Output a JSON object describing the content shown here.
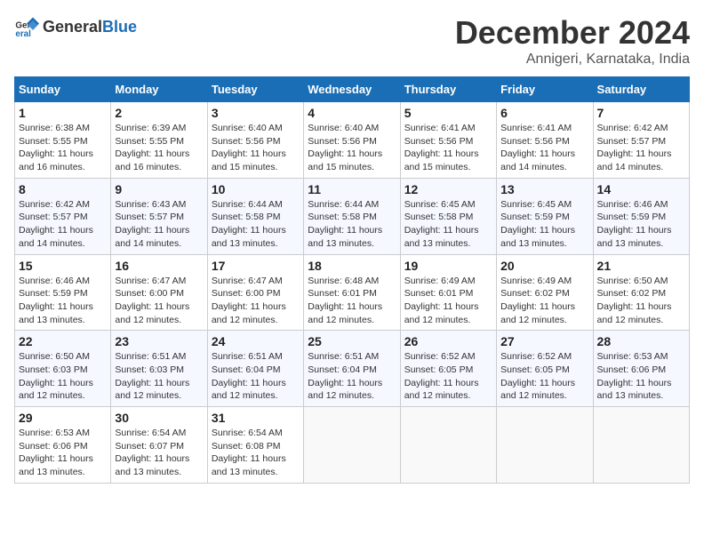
{
  "logo": {
    "text_general": "General",
    "text_blue": "Blue"
  },
  "title": "December 2024",
  "subtitle": "Annigeri, Karnataka, India",
  "weekdays": [
    "Sunday",
    "Monday",
    "Tuesday",
    "Wednesday",
    "Thursday",
    "Friday",
    "Saturday"
  ],
  "weeks": [
    [
      {
        "day": "1",
        "sunrise": "Sunrise: 6:38 AM",
        "sunset": "Sunset: 5:55 PM",
        "daylight": "Daylight: 11 hours and 16 minutes."
      },
      {
        "day": "2",
        "sunrise": "Sunrise: 6:39 AM",
        "sunset": "Sunset: 5:55 PM",
        "daylight": "Daylight: 11 hours and 16 minutes."
      },
      {
        "day": "3",
        "sunrise": "Sunrise: 6:40 AM",
        "sunset": "Sunset: 5:56 PM",
        "daylight": "Daylight: 11 hours and 15 minutes."
      },
      {
        "day": "4",
        "sunrise": "Sunrise: 6:40 AM",
        "sunset": "Sunset: 5:56 PM",
        "daylight": "Daylight: 11 hours and 15 minutes."
      },
      {
        "day": "5",
        "sunrise": "Sunrise: 6:41 AM",
        "sunset": "Sunset: 5:56 PM",
        "daylight": "Daylight: 11 hours and 15 minutes."
      },
      {
        "day": "6",
        "sunrise": "Sunrise: 6:41 AM",
        "sunset": "Sunset: 5:56 PM",
        "daylight": "Daylight: 11 hours and 14 minutes."
      },
      {
        "day": "7",
        "sunrise": "Sunrise: 6:42 AM",
        "sunset": "Sunset: 5:57 PM",
        "daylight": "Daylight: 11 hours and 14 minutes."
      }
    ],
    [
      {
        "day": "8",
        "sunrise": "Sunrise: 6:42 AM",
        "sunset": "Sunset: 5:57 PM",
        "daylight": "Daylight: 11 hours and 14 minutes."
      },
      {
        "day": "9",
        "sunrise": "Sunrise: 6:43 AM",
        "sunset": "Sunset: 5:57 PM",
        "daylight": "Daylight: 11 hours and 14 minutes."
      },
      {
        "day": "10",
        "sunrise": "Sunrise: 6:44 AM",
        "sunset": "Sunset: 5:58 PM",
        "daylight": "Daylight: 11 hours and 13 minutes."
      },
      {
        "day": "11",
        "sunrise": "Sunrise: 6:44 AM",
        "sunset": "Sunset: 5:58 PM",
        "daylight": "Daylight: 11 hours and 13 minutes."
      },
      {
        "day": "12",
        "sunrise": "Sunrise: 6:45 AM",
        "sunset": "Sunset: 5:58 PM",
        "daylight": "Daylight: 11 hours and 13 minutes."
      },
      {
        "day": "13",
        "sunrise": "Sunrise: 6:45 AM",
        "sunset": "Sunset: 5:59 PM",
        "daylight": "Daylight: 11 hours and 13 minutes."
      },
      {
        "day": "14",
        "sunrise": "Sunrise: 6:46 AM",
        "sunset": "Sunset: 5:59 PM",
        "daylight": "Daylight: 11 hours and 13 minutes."
      }
    ],
    [
      {
        "day": "15",
        "sunrise": "Sunrise: 6:46 AM",
        "sunset": "Sunset: 5:59 PM",
        "daylight": "Daylight: 11 hours and 13 minutes."
      },
      {
        "day": "16",
        "sunrise": "Sunrise: 6:47 AM",
        "sunset": "Sunset: 6:00 PM",
        "daylight": "Daylight: 11 hours and 12 minutes."
      },
      {
        "day": "17",
        "sunrise": "Sunrise: 6:47 AM",
        "sunset": "Sunset: 6:00 PM",
        "daylight": "Daylight: 11 hours and 12 minutes."
      },
      {
        "day": "18",
        "sunrise": "Sunrise: 6:48 AM",
        "sunset": "Sunset: 6:01 PM",
        "daylight": "Daylight: 11 hours and 12 minutes."
      },
      {
        "day": "19",
        "sunrise": "Sunrise: 6:49 AM",
        "sunset": "Sunset: 6:01 PM",
        "daylight": "Daylight: 11 hours and 12 minutes."
      },
      {
        "day": "20",
        "sunrise": "Sunrise: 6:49 AM",
        "sunset": "Sunset: 6:02 PM",
        "daylight": "Daylight: 11 hours and 12 minutes."
      },
      {
        "day": "21",
        "sunrise": "Sunrise: 6:50 AM",
        "sunset": "Sunset: 6:02 PM",
        "daylight": "Daylight: 11 hours and 12 minutes."
      }
    ],
    [
      {
        "day": "22",
        "sunrise": "Sunrise: 6:50 AM",
        "sunset": "Sunset: 6:03 PM",
        "daylight": "Daylight: 11 hours and 12 minutes."
      },
      {
        "day": "23",
        "sunrise": "Sunrise: 6:51 AM",
        "sunset": "Sunset: 6:03 PM",
        "daylight": "Daylight: 11 hours and 12 minutes."
      },
      {
        "day": "24",
        "sunrise": "Sunrise: 6:51 AM",
        "sunset": "Sunset: 6:04 PM",
        "daylight": "Daylight: 11 hours and 12 minutes."
      },
      {
        "day": "25",
        "sunrise": "Sunrise: 6:51 AM",
        "sunset": "Sunset: 6:04 PM",
        "daylight": "Daylight: 11 hours and 12 minutes."
      },
      {
        "day": "26",
        "sunrise": "Sunrise: 6:52 AM",
        "sunset": "Sunset: 6:05 PM",
        "daylight": "Daylight: 11 hours and 12 minutes."
      },
      {
        "day": "27",
        "sunrise": "Sunrise: 6:52 AM",
        "sunset": "Sunset: 6:05 PM",
        "daylight": "Daylight: 11 hours and 12 minutes."
      },
      {
        "day": "28",
        "sunrise": "Sunrise: 6:53 AM",
        "sunset": "Sunset: 6:06 PM",
        "daylight": "Daylight: 11 hours and 13 minutes."
      }
    ],
    [
      {
        "day": "29",
        "sunrise": "Sunrise: 6:53 AM",
        "sunset": "Sunset: 6:06 PM",
        "daylight": "Daylight: 11 hours and 13 minutes."
      },
      {
        "day": "30",
        "sunrise": "Sunrise: 6:54 AM",
        "sunset": "Sunset: 6:07 PM",
        "daylight": "Daylight: 11 hours and 13 minutes."
      },
      {
        "day": "31",
        "sunrise": "Sunrise: 6:54 AM",
        "sunset": "Sunset: 6:08 PM",
        "daylight": "Daylight: 11 hours and 13 minutes."
      },
      null,
      null,
      null,
      null
    ]
  ]
}
